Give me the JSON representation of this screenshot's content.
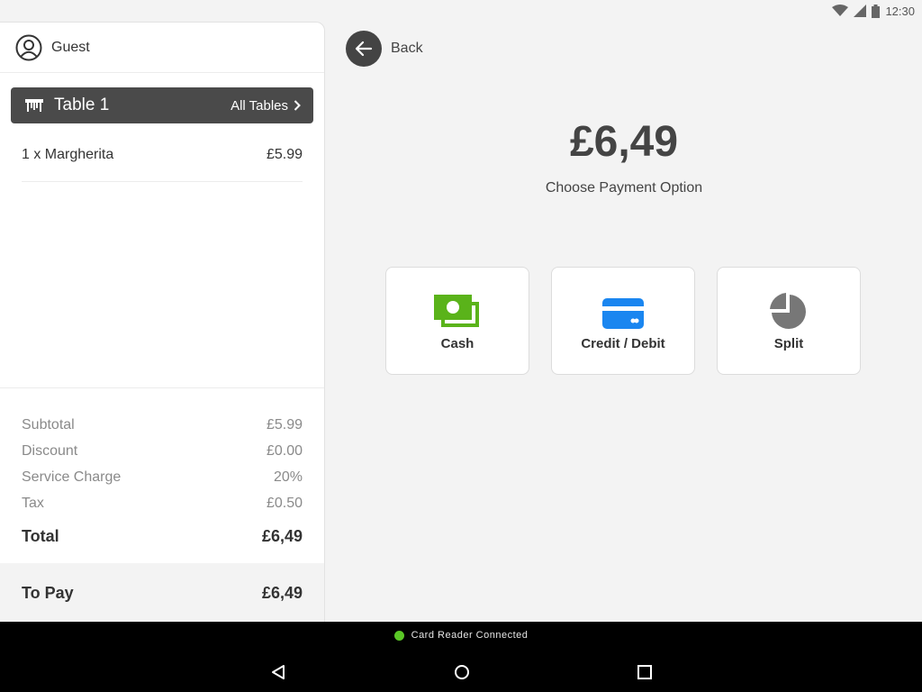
{
  "status": {
    "time": "12:30",
    "icons": [
      "wifi-icon",
      "cell-signal-icon",
      "battery-icon"
    ]
  },
  "guest": {
    "label": "Guest",
    "icon": "user-circle-icon"
  },
  "table": {
    "name": "Table 1",
    "all_label": "All Tables",
    "icon": "table-icon"
  },
  "order": {
    "items": [
      {
        "label": "1 x Margherita",
        "price": "£5.99"
      }
    ]
  },
  "summary": {
    "subtotal_label": "Subtotal",
    "subtotal": "£5.99",
    "discount_label": "Discount",
    "discount": "£0.00",
    "service_label": "Service Charge",
    "service": "20%",
    "tax_label": "Tax",
    "tax": "£0.50",
    "total_label": "Total",
    "total": "£6,49"
  },
  "topay": {
    "label": "To Pay",
    "value": "£6,49"
  },
  "back": {
    "label": "Back"
  },
  "payment": {
    "amount": "£6,49",
    "prompt": "Choose Payment Option",
    "options": [
      {
        "label": "Cash",
        "icon": "cash-icon",
        "color": "#5ab31a"
      },
      {
        "label": "Credit / Debit",
        "icon": "credit-card-icon",
        "color": "#1a86f0"
      },
      {
        "label": "Split",
        "icon": "pie-chart-icon",
        "color": "#777777"
      }
    ]
  },
  "footer": {
    "reader_status": "Card Reader Connected",
    "reader_color": "#5ac726"
  }
}
